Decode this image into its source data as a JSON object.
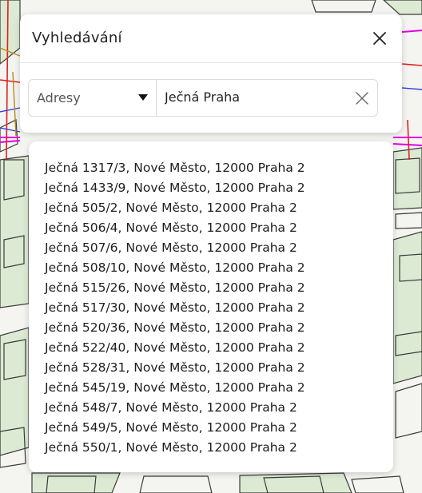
{
  "panel": {
    "title": "Vyhledávání"
  },
  "search": {
    "type_value": "Adresy",
    "query": "Ječná Praha"
  },
  "results": [
    "Ječná 1317/3, Nové Město, 12000 Praha 2",
    "Ječná 1433/9, Nové Město, 12000 Praha 2",
    "Ječná 505/2, Nové Město, 12000 Praha 2",
    "Ječná 506/4, Nové Město, 12000 Praha 2",
    "Ječná 507/6, Nové Město, 12000 Praha 2",
    "Ječná 508/10, Nové Město, 12000 Praha 2",
    "Ječná 515/26, Nové Město, 12000 Praha 2",
    "Ječná 517/30, Nové Město, 12000 Praha 2",
    "Ječná 520/36, Nové Město, 12000 Praha 2",
    "Ječná 522/40, Nové Město, 12000 Praha 2",
    "Ječná 528/31, Nové Město, 12000 Praha 2",
    "Ječná 545/19, Nové Město, 12000 Praha 2",
    "Ječná 548/7, Nové Město, 12000 Praha 2",
    "Ječná 549/5, Nové Město, 12000 Praha 2",
    "Ječná 550/1, Nové Město, 12000 Praha 2"
  ],
  "colors": {
    "map_background": "#f4f4f1",
    "park_green": "#dcead3",
    "building_line": "#3a3a3a",
    "boundary_magenta": "#e000e0",
    "road_red": "#e02020",
    "blue_line": "#3040e0"
  },
  "icons": {
    "close": "close-icon",
    "clear": "clear-icon",
    "dropdown": "caret-down-icon"
  }
}
